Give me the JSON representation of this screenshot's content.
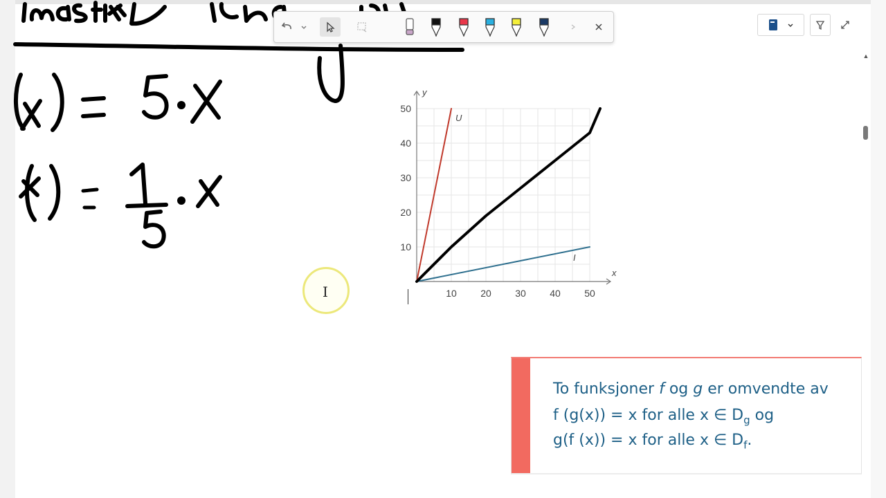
{
  "colors": {
    "accent_red": "#f26a60",
    "formula_blue": "#1d5f86",
    "line_u": "#c0392b",
    "line_i": "#2e6f8e",
    "ink": "#000000"
  },
  "toolbar": {
    "buttons": [
      {
        "name": "undo",
        "icon": "undo-icon"
      },
      {
        "name": "undo-dropdown",
        "icon": "chevron-down-icon"
      },
      {
        "name": "select",
        "icon": "pointer-icon",
        "active": true
      },
      {
        "name": "lasso",
        "icon": "lasso-icon"
      }
    ],
    "pens": [
      {
        "name": "eraser",
        "color": "#c9a6c9"
      },
      {
        "name": "pen-black",
        "color": "#111111"
      },
      {
        "name": "pen-red",
        "color": "#e8374a"
      },
      {
        "name": "pen-cyan",
        "color": "#2ab0e0"
      },
      {
        "name": "pen-yellow",
        "color": "#f4ef3a"
      },
      {
        "name": "pen-navy",
        "color": "#1b3a66"
      }
    ]
  },
  "chart_data": {
    "type": "line",
    "x_axis_label": "x",
    "y_axis_label": "y",
    "xlim": [
      0,
      50
    ],
    "ylim": [
      0,
      50
    ],
    "x_ticks": [
      "10",
      "20",
      "30",
      "40",
      "50"
    ],
    "y_ticks": [
      "10",
      "20",
      "30",
      "40",
      "50"
    ],
    "grid": true,
    "series": [
      {
        "name": "U",
        "color": "#c0392b",
        "x": [
          0,
          10
        ],
        "y": [
          0,
          50
        ]
      },
      {
        "name": "I",
        "color": "#2e6f8e",
        "x": [
          0,
          50
        ],
        "y": [
          0,
          10
        ]
      },
      {
        "color": "#000000",
        "x": [
          0,
          10,
          20,
          30,
          40,
          50,
          53
        ],
        "y": [
          0,
          10,
          19,
          27,
          35,
          43,
          50
        ]
      }
    ]
  },
  "definition": {
    "line1_text": "To funksjoner ",
    "line1_f": "f",
    "line1_og": " og ",
    "line1_g": "g",
    "line1_rest": " er omvendte av",
    "line2": "f (g(x)) = x for alle x ∈ D",
    "line2_sub": "g",
    "line2_tail": " og",
    "line3": "g(f (x)) = x for alle x ∈ D",
    "line3_sub": "f",
    "line3_tail": "."
  }
}
